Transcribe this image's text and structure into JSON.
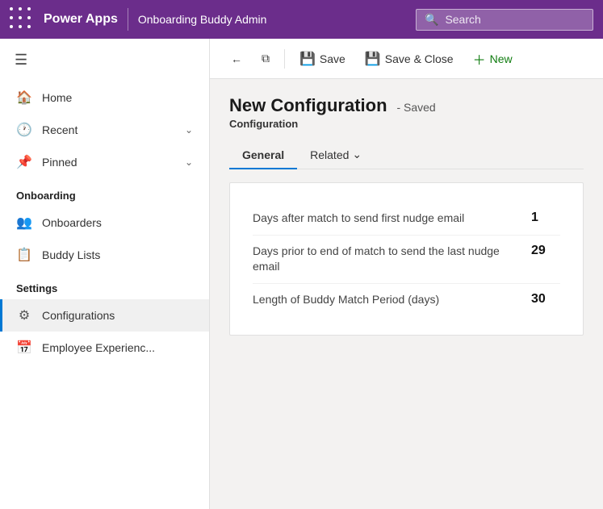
{
  "topbar": {
    "app_title": "Power Apps",
    "app_name": "Onboarding Buddy Admin",
    "search_placeholder": "Search"
  },
  "toolbar": {
    "back_label": "←",
    "open_label": "⧉",
    "save_label": "Save",
    "save_close_label": "Save & Close",
    "new_label": "New"
  },
  "record": {
    "title": "New Configuration",
    "status": "- Saved",
    "type": "Configuration"
  },
  "tabs": [
    {
      "id": "general",
      "label": "General",
      "active": true
    },
    {
      "id": "related",
      "label": "Related",
      "active": false
    }
  ],
  "form": {
    "fields": [
      {
        "label": "Days after match to send first nudge email",
        "value": "1"
      },
      {
        "label": "Days prior to end of match to send the last nudge email",
        "value": "29"
      },
      {
        "label": "Length of Buddy Match Period (days)",
        "value": "30"
      }
    ]
  },
  "sidebar": {
    "nav_items": [
      {
        "id": "home",
        "icon": "🏠",
        "label": "Home",
        "chevron": false
      },
      {
        "id": "recent",
        "icon": "🕐",
        "label": "Recent",
        "chevron": true
      },
      {
        "id": "pinned",
        "icon": "📌",
        "label": "Pinned",
        "chevron": true
      }
    ],
    "sections": [
      {
        "title": "Onboarding",
        "items": [
          {
            "id": "onboarders",
            "icon": "👥",
            "label": "Onboarders",
            "active": false
          },
          {
            "id": "buddy-lists",
            "icon": "📋",
            "label": "Buddy Lists",
            "active": false
          }
        ]
      },
      {
        "title": "Settings",
        "items": [
          {
            "id": "configurations",
            "icon": "⚙",
            "label": "Configurations",
            "active": true
          },
          {
            "id": "employee-experience",
            "icon": "📅",
            "label": "Employee Experienc...",
            "active": false
          }
        ]
      }
    ]
  }
}
